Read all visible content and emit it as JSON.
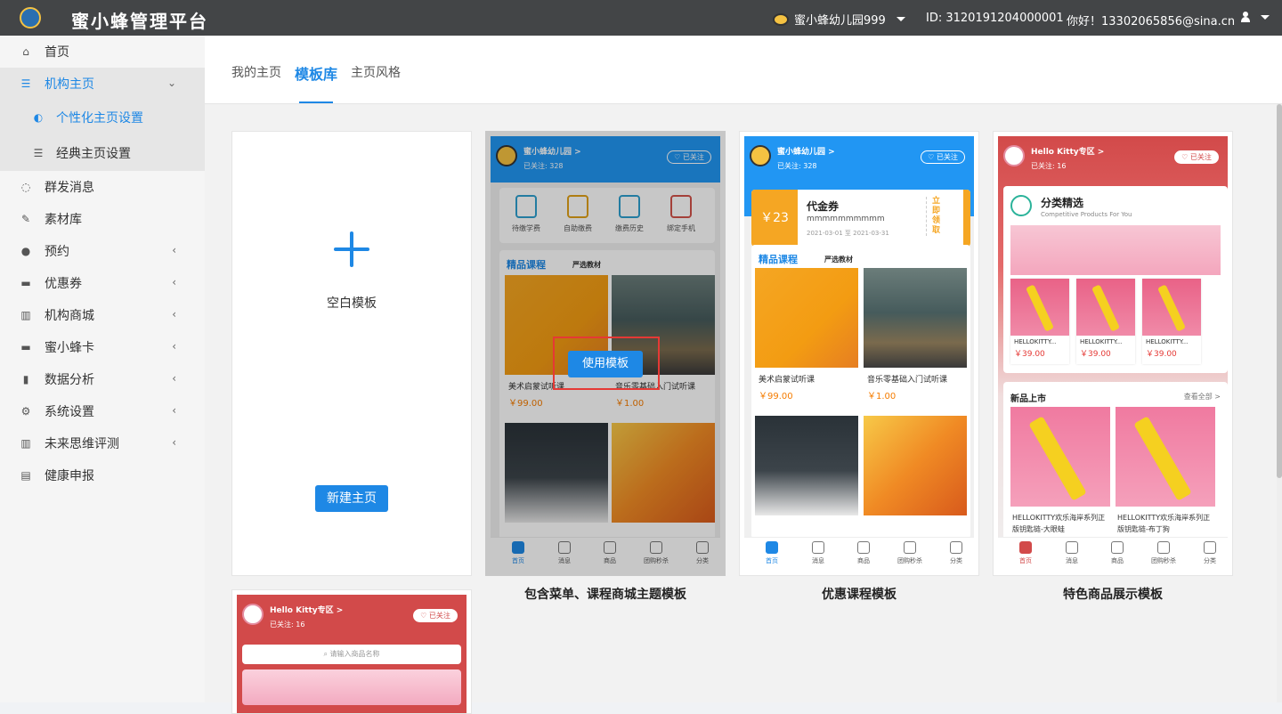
{
  "header": {
    "app_title": "蜜小蜂管理平台",
    "org_name": "蜜小蜂幼儿园999",
    "org_id": "ID:  3120191204000001",
    "greeting": "你好！13302065856@sina.cn"
  },
  "sidebar": {
    "items": [
      {
        "label": "首页",
        "icon": "home-icon"
      },
      {
        "label": "机构主页",
        "icon": "list-icon",
        "expanded": true
      },
      {
        "label": "群发消息",
        "icon": "chat-icon"
      },
      {
        "label": "素材库",
        "icon": "edit-icon"
      },
      {
        "label": "预约",
        "icon": "group-icon"
      },
      {
        "label": "优惠券",
        "icon": "card-icon"
      },
      {
        "label": "机构商城",
        "icon": "building-icon"
      },
      {
        "label": "蜜小蜂卡",
        "icon": "card-icon"
      },
      {
        "label": "数据分析",
        "icon": "bar-chart-icon"
      },
      {
        "label": "系统设置",
        "icon": "gears-icon"
      },
      {
        "label": "未来思维评测",
        "icon": "building-icon"
      },
      {
        "label": "健康申报",
        "icon": "id-card-icon"
      }
    ],
    "sub_items": [
      {
        "label": "个性化主页设置",
        "icon": "palette-icon"
      },
      {
        "label": "经典主页设置",
        "icon": "list-icon"
      }
    ]
  },
  "tabs": {
    "my_home": "我的主页",
    "template_lib": "模板库",
    "home_style": "主页风格"
  },
  "blank_template": {
    "label": "空白模板",
    "new_button": "新建主页"
  },
  "template1": {
    "caption": "包含菜单、课程商城主题模板",
    "use_button": "使用模板",
    "org_name": "蜜小蜂幼儿园 >",
    "followers": "已关注: 328",
    "follow_state": "♡ 已关注",
    "quick_links": [
      "待缴学费",
      "自助缴费",
      "缴费历史",
      "绑定手机"
    ],
    "section_title": "精品课程",
    "section_sub": "严选教材",
    "courses": [
      {
        "name": "美术启蒙试听课",
        "price": "￥99.00"
      },
      {
        "name": "音乐零基础入门试听课",
        "price": "￥1.00"
      }
    ],
    "nav": [
      "首页",
      "消息",
      "商品",
      "团购秒杀",
      "分类"
    ]
  },
  "template2": {
    "caption": "优惠课程模板",
    "org_name": "蜜小蜂幼儿园 >",
    "followers": "已关注: 328",
    "follow_state": "♡ 已关注",
    "coupon": {
      "amount": "￥23",
      "title": "代金券",
      "desc": "mmmmmmmmmm",
      "date": "2021-03-01 至 2021-03-31",
      "tag": "立即领取"
    },
    "section_title": "精品课程",
    "section_sub": "严选教材",
    "courses": [
      {
        "name": "美术启蒙试听课",
        "price": "￥99.00"
      },
      {
        "name": "音乐零基础入门试听课",
        "price": "￥1.00"
      }
    ],
    "nav": [
      "首页",
      "消息",
      "商品",
      "团购秒杀",
      "分类"
    ]
  },
  "template3": {
    "caption": "特色商品展示模板",
    "org_name": "Hello Kitty专区 >",
    "followers": "已关注: 16",
    "follow_state": "♡ 已关注",
    "featured_title": "分类精选",
    "featured_sub": "Competitive Products For You",
    "products": [
      {
        "name": "HELLOKITTY...",
        "price": "￥39.00"
      },
      {
        "name": "HELLOKITTY...",
        "price": "￥39.00"
      },
      {
        "name": "HELLOKITTY...",
        "price": "￥39.00"
      }
    ],
    "new_title": "新品上市",
    "view_all": "查看全部 >",
    "new_products": [
      {
        "name": "HELLOKITTY欢乐海岸系列正版钥匙链-大眼蛙"
      },
      {
        "name": "HELLOKITTY欢乐海岸系列正版钥匙链-布丁狗"
      }
    ],
    "nav": [
      "首页",
      "消息",
      "商品",
      "团购秒杀",
      "分类"
    ]
  },
  "template4": {
    "org_name": "Hello Kitty专区 >",
    "followers": "已关注: 16",
    "follow_state": "♡ 已关注",
    "search_placeholder": "请输入商品名称"
  },
  "colors": {
    "accent": "#1e88e5",
    "topbar": "#434547",
    "highlight_box": "#e53935"
  }
}
